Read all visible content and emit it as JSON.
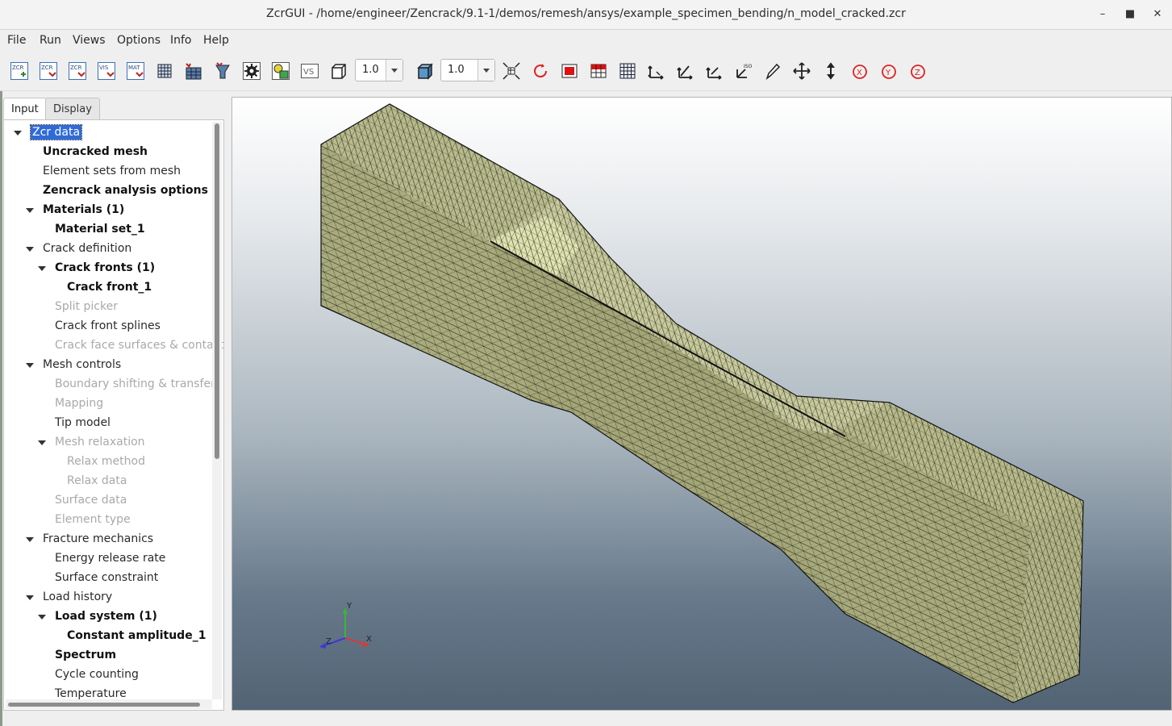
{
  "window": {
    "title": "ZcrGUI - /home/engineer/Zencrack/9.1-1/demos/remesh/ansys/example_specimen_bending/n_model_cracked.zcr",
    "controls": [
      "minimize-icon",
      "maximize-icon",
      "close-icon"
    ]
  },
  "menu": {
    "items": [
      "File",
      "Run",
      "Views",
      "Options",
      "Info",
      "Help"
    ]
  },
  "toolbar": {
    "zcr_new": "ZCR",
    "zcr_open": "ZCR",
    "zcr_save": "ZCR",
    "vis": "VIS",
    "mat": "MAT",
    "vs": "VS",
    "scale1": "1.0",
    "scale2": "1.0",
    "icons": [
      "zcr-new-icon",
      "zcr-open-icon",
      "zcr-save-icon",
      "vis-icon",
      "mat-icon",
      "mesh-grid-icon",
      "element-table-icon",
      "funnel-icon",
      "settings-gear-icon",
      "results-icon",
      "vs-icon",
      "wireframe-box-icon",
      "solid-box-icon",
      "fit-view-icon",
      "rotate-icon",
      "red-cube-icon",
      "red-grid-icon",
      "grid-icon",
      "view-xy-icon",
      "view-xz-icon",
      "view-yz-icon",
      "view-iso-icon",
      "pen-icon",
      "pan-icon",
      "zoom-icon",
      "rotate-x-icon",
      "rotate-y-icon",
      "rotate-z-icon"
    ]
  },
  "tabs": [
    "Input",
    "Display"
  ],
  "tree": [
    {
      "label": "Zcr data",
      "level": 0,
      "expander": true,
      "style": "selected"
    },
    {
      "label": "Uncracked mesh",
      "level": 1,
      "expander": false,
      "style": "bold"
    },
    {
      "label": "Element sets from mesh",
      "level": 1,
      "expander": false,
      "style": "normal"
    },
    {
      "label": "Zencrack analysis options",
      "level": 1,
      "expander": false,
      "style": "bold"
    },
    {
      "label": "Materials (1)",
      "level": 1,
      "expander": true,
      "style": "bold"
    },
    {
      "label": "Material set_1",
      "level": 2,
      "expander": false,
      "style": "bold"
    },
    {
      "label": "Crack definition",
      "level": 1,
      "expander": true,
      "style": "normal"
    },
    {
      "label": "Crack fronts (1)",
      "level": 2,
      "expander": true,
      "style": "bold"
    },
    {
      "label": "Crack front_1",
      "level": 3,
      "expander": false,
      "style": "bold"
    },
    {
      "label": "Split picker",
      "level": 2,
      "expander": false,
      "style": "dim"
    },
    {
      "label": "Crack front splines",
      "level": 2,
      "expander": false,
      "style": "normal"
    },
    {
      "label": "Crack face surfaces & contact",
      "level": 2,
      "expander": false,
      "style": "dim"
    },
    {
      "label": "Mesh controls",
      "level": 1,
      "expander": true,
      "style": "normal"
    },
    {
      "label": "Boundary shifting & transfer",
      "level": 2,
      "expander": false,
      "style": "dim"
    },
    {
      "label": "Mapping",
      "level": 2,
      "expander": false,
      "style": "dim"
    },
    {
      "label": "Tip model",
      "level": 2,
      "expander": false,
      "style": "normal"
    },
    {
      "label": "Mesh relaxation",
      "level": 2,
      "expander": true,
      "style": "dim"
    },
    {
      "label": "Relax method",
      "level": 3,
      "expander": false,
      "style": "dim"
    },
    {
      "label": "Relax data",
      "level": 3,
      "expander": false,
      "style": "dim"
    },
    {
      "label": "Surface data",
      "level": 2,
      "expander": false,
      "style": "dim"
    },
    {
      "label": "Element type",
      "level": 2,
      "expander": false,
      "style": "dim"
    },
    {
      "label": "Fracture mechanics",
      "level": 1,
      "expander": true,
      "style": "normal"
    },
    {
      "label": "Energy release rate",
      "level": 2,
      "expander": false,
      "style": "normal"
    },
    {
      "label": "Surface constraint",
      "level": 2,
      "expander": false,
      "style": "normal"
    },
    {
      "label": "Load history",
      "level": 1,
      "expander": true,
      "style": "normal"
    },
    {
      "label": "Load system (1)",
      "level": 2,
      "expander": true,
      "style": "bold"
    },
    {
      "label": "Constant amplitude_1",
      "level": 3,
      "expander": false,
      "style": "bold"
    },
    {
      "label": "Spectrum",
      "level": 2,
      "expander": false,
      "style": "bold"
    },
    {
      "label": "Cycle counting",
      "level": 2,
      "expander": false,
      "style": "normal"
    },
    {
      "label": "Temperature",
      "level": 2,
      "expander": false,
      "style": "normal"
    }
  ],
  "viewport": {
    "mesh_color": "#b7b98a",
    "axes": {
      "x": "X",
      "y": "Y",
      "z": "Z"
    },
    "axis_colors": {
      "x": "#d63a3a",
      "y": "#3cb43c",
      "z": "#3a3ad6"
    }
  }
}
